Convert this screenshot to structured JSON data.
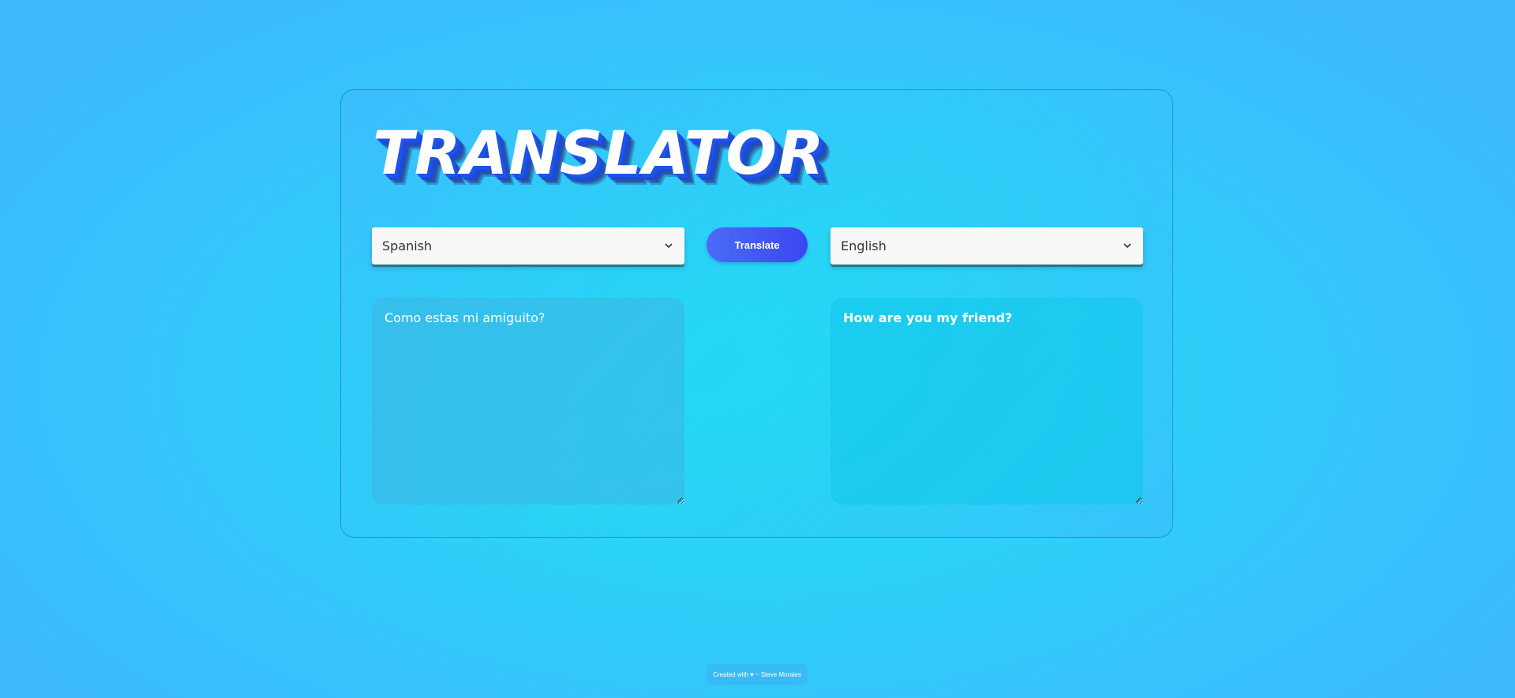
{
  "app": {
    "title": "TRANSLATOR"
  },
  "source_language": {
    "selected": "Spanish",
    "icon": "chevron-down-icon"
  },
  "target_language": {
    "selected": "English",
    "icon": "chevron-down-icon"
  },
  "actions": {
    "translate_label": "Translate"
  },
  "source_text": {
    "value": "Como estas mi amiguito?"
  },
  "target_text": {
    "value": "How are you my friend?"
  },
  "footer": {
    "prefix": "Created with",
    "heart": "♥",
    "suffix": "~ Steve Morales"
  },
  "colors": {
    "button": "#3b46f0",
    "title_shadow": "#1e54e8",
    "background": "#2ad3f7"
  }
}
